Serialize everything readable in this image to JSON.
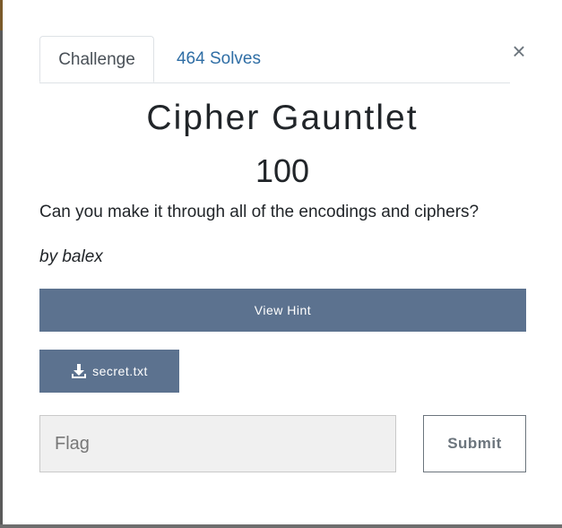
{
  "tabs": {
    "challenge": "Challenge",
    "solves": "464 Solves"
  },
  "close_icon": "×",
  "challenge": {
    "name": "Cipher Gauntlet",
    "value": "100",
    "description": "Can you make it through all of the encodings and ciphers?",
    "author": "by balex"
  },
  "buttons": {
    "hint": "View Hint",
    "file": "secret.txt",
    "file_icon": "download-icon",
    "submit": "Submit"
  },
  "flag_input": {
    "placeholder": "Flag",
    "value": ""
  },
  "colors": {
    "primary_button": "#5c728f",
    "link": "#2f6ea5",
    "input_bg": "#f0f0f0"
  }
}
